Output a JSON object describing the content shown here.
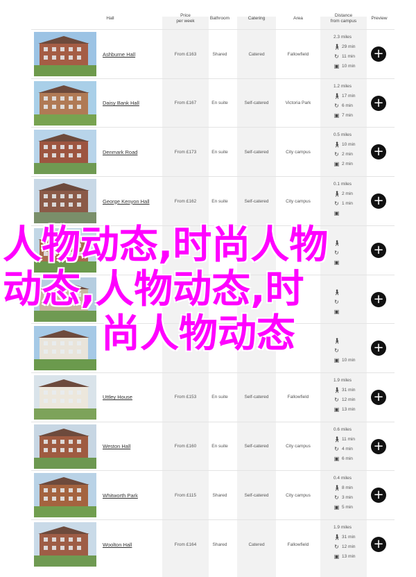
{
  "header": {
    "hall": "Hall",
    "price": "Price\nper week",
    "bathroom": "Bathroom",
    "catering": "Catering",
    "area": "Area",
    "distance": "Distance\nfrom campus",
    "preview": "Preview"
  },
  "rows": [
    {
      "name": "Ashburne Hall",
      "price": "From £163",
      "bathroom": "Shared",
      "catering": "Catered",
      "area": "Fallowfield",
      "distance": "2.3 miles",
      "walk": "29 min",
      "cycle": "11 min",
      "bus": "10 min"
    },
    {
      "name": "Daisy Bank Hall",
      "price": "From £167",
      "bathroom": "En suite",
      "catering": "Self-catered",
      "area": "Victoria Park",
      "distance": "1.2 miles",
      "walk": "17 min",
      "cycle": "6 min",
      "bus": "7 min"
    },
    {
      "name": "Denmark Road",
      "price": "From £173",
      "bathroom": "En suite",
      "catering": "Self-catered",
      "area": "City campus",
      "distance": "0.5 miles",
      "walk": "10 min",
      "cycle": "2 min",
      "bus": "2 min"
    },
    {
      "name": "George Kenyon Hall",
      "price": "From £162",
      "bathroom": "En suite",
      "catering": "Self-catered",
      "area": "City campus",
      "distance": "0.1 miles",
      "walk": "2 min",
      "cycle": "1 min",
      "bus": ""
    },
    {
      "name": "",
      "price": "",
      "bathroom": "",
      "catering": "",
      "area": "",
      "distance": "",
      "walk": "",
      "cycle": "",
      "bus": ""
    },
    {
      "name": "",
      "price": "",
      "bathroom": "",
      "catering": "",
      "area": "",
      "distance": "",
      "walk": "",
      "cycle": "",
      "bus": ""
    },
    {
      "name": "",
      "price": "",
      "bathroom": "",
      "catering": "",
      "area": "",
      "distance": "",
      "walk": "",
      "cycle": "",
      "bus": "10 min"
    },
    {
      "name": "Uttley House",
      "price": "From £153",
      "bathroom": "En suite",
      "catering": "Self-catered",
      "area": "Fallowfield",
      "distance": "1.9 miles",
      "walk": "31 min",
      "cycle": "12 min",
      "bus": "13 min"
    },
    {
      "name": "Weston Hall",
      "price": "From £160",
      "bathroom": "En suite",
      "catering": "Self-catered",
      "area": "City campus",
      "distance": "0.6 miles",
      "walk": "11 min",
      "cycle": "4 min",
      "bus": "6 min"
    },
    {
      "name": "Whitworth Park",
      "price": "From £115",
      "bathroom": "Shared",
      "catering": "Self-catered",
      "area": "City campus",
      "distance": "0.4 miles",
      "walk": "8 min",
      "cycle": "3 min",
      "bus": "5 min"
    },
    {
      "name": "Woolton Hall",
      "price": "From £164",
      "bathroom": "Shared",
      "catering": "Catered",
      "area": "Fallowfield",
      "distance": "1.9 miles",
      "walk": "31 min",
      "cycle": "12 min",
      "bus": "13 min"
    }
  ],
  "overlay": {
    "line1": "人物动态,时尚人物",
    "line2": "动态,人物动态,时",
    "line3": "尚人物动态"
  },
  "icons": {
    "walk": "walk-icon",
    "cycle": "bicycle-icon",
    "bus": "bus-icon",
    "preview": "plus-icon"
  }
}
